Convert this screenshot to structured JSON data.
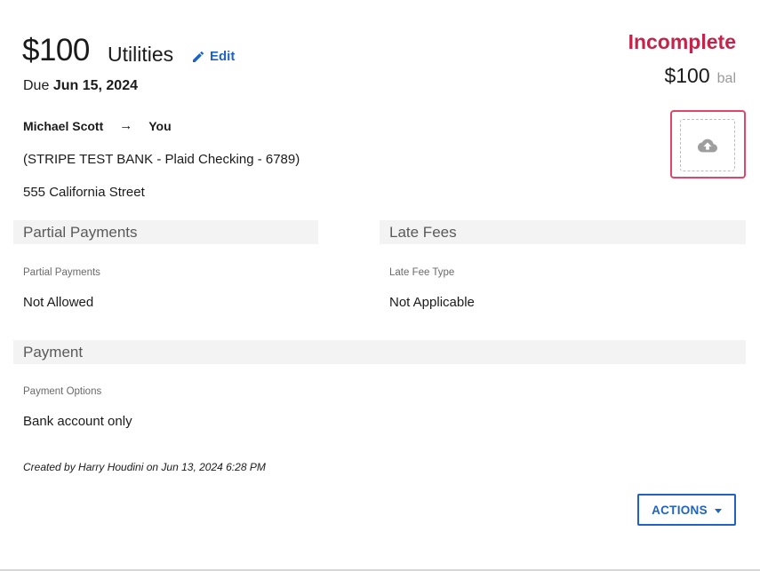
{
  "bill": {
    "amount": "$100",
    "category": "Utilities",
    "edit_label": "Edit",
    "due_prefix": "Due",
    "due_date": "Jun 15, 2024"
  },
  "status": {
    "label": "Incomplete",
    "balance_amount": "$100",
    "balance_suffix": "bal"
  },
  "upload": {
    "icon": "cloud-upload-icon"
  },
  "parties": {
    "from": "Michael Scott",
    "arrow": "→",
    "to": "You",
    "bank_account": "(STRIPE TEST BANK - Plaid Checking - 6789)",
    "address": "555 California Street"
  },
  "partial_payments": {
    "header": "Partial Payments",
    "field_label": "Partial Payments",
    "field_value": "Not Allowed"
  },
  "late_fees": {
    "header": "Late Fees",
    "field_label": "Late Fee Type",
    "field_value": "Not Applicable"
  },
  "payment": {
    "header": "Payment",
    "field_label": "Payment Options",
    "field_value": "Bank account only"
  },
  "footer": {
    "created_text": "Created by Harry Houdini on Jun 13, 2024 6:28 PM",
    "actions_label": "ACTIONS"
  },
  "colors": {
    "accent_blue": "#1f62c4",
    "status_red": "#c4244a",
    "upload_border": "#e24569",
    "section_bg": "#f3f3f4"
  }
}
